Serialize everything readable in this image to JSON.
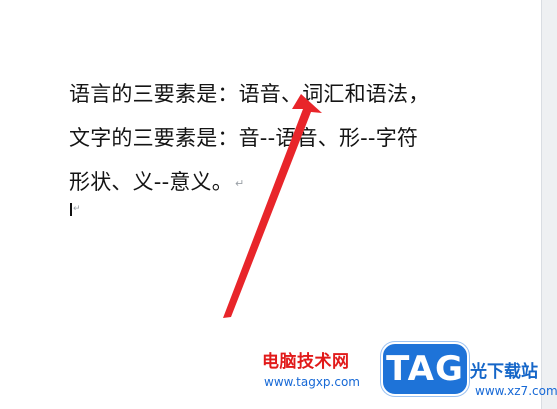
{
  "document": {
    "lines": [
      "语言的三要素是：语音、词汇和语法，",
      "文字的三要素是：音--语音、形--字符",
      "形状、义--意义。"
    ],
    "paragraph_mark": "↵",
    "cursor_mark": "↵"
  },
  "annotation": {
    "arrow_color": "#e8252a"
  },
  "watermark": {
    "site_name": "电脑技术网",
    "site_url": "www.tagxp.com",
    "logo_text": "TAG",
    "brand_text": "光下载站",
    "brand_url": "www.xz7.com",
    "logo_color": "#1e73d8"
  }
}
